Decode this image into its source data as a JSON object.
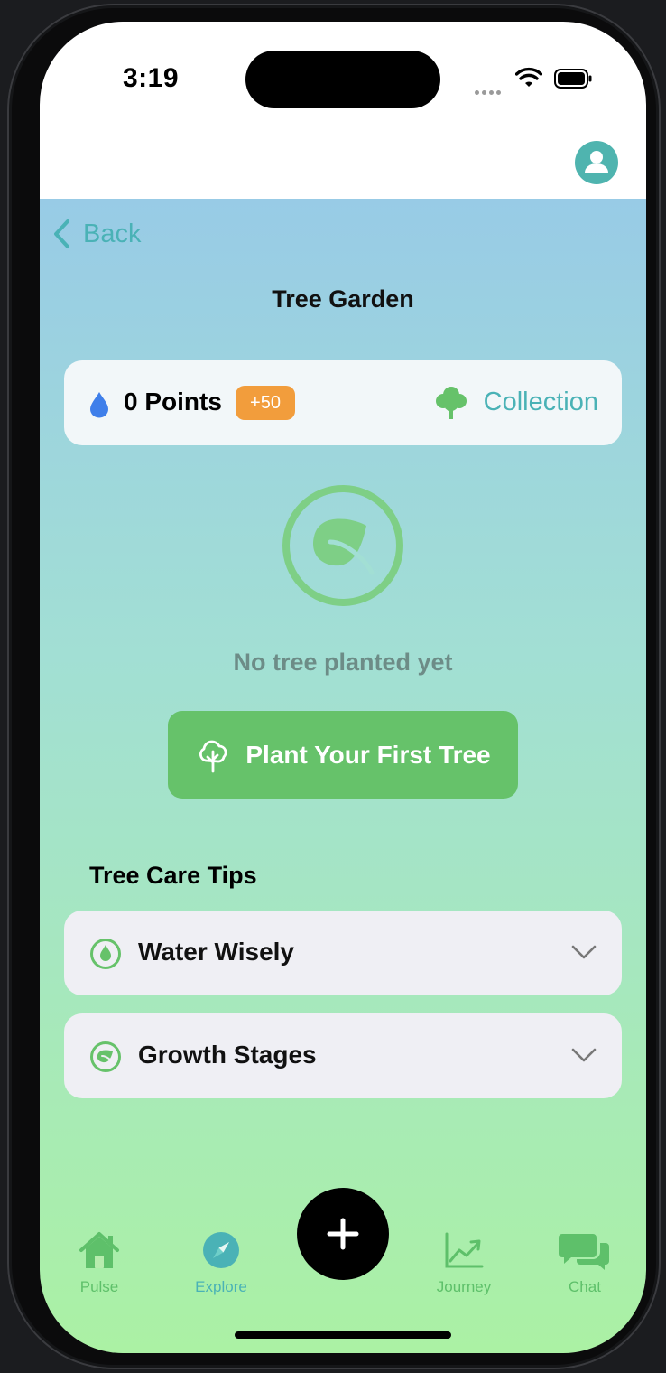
{
  "status_bar": {
    "time": "3:19"
  },
  "nav": {
    "back_label": "Back",
    "page_title": "Tree Garden"
  },
  "points_card": {
    "points_label": "0 Points",
    "bonus_badge": "+50",
    "collection_label": "Collection"
  },
  "empty_state": {
    "message": "No tree planted yet",
    "button_label": "Plant Your First Tree"
  },
  "tips": {
    "heading": "Tree Care Tips",
    "items": [
      {
        "label": "Water Wisely",
        "icon": "water-drop-icon"
      },
      {
        "label": "Growth Stages",
        "icon": "leaf-icon"
      }
    ]
  },
  "tab_bar": {
    "items": [
      {
        "label": "Pulse",
        "icon": "home-icon",
        "active": false
      },
      {
        "label": "Explore",
        "icon": "compass-icon",
        "active": true
      },
      {
        "label": "Journey",
        "icon": "chart-icon",
        "active": false
      },
      {
        "label": "Chat",
        "icon": "chat-bubbles-icon",
        "active": false
      }
    ],
    "fab_icon": "plus-icon"
  },
  "colors": {
    "accent_teal": "#4ab2b6",
    "accent_green": "#66c26a",
    "badge_orange": "#f29d3c",
    "tab_active": "#4ab2b6",
    "tab_inactive": "#5ec06a"
  }
}
